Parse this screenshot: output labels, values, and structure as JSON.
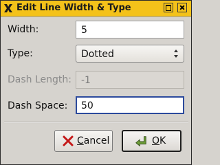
{
  "window": {
    "title": "Edit Line Width & Type",
    "title_color": "#f4c21a"
  },
  "form": {
    "width": {
      "label": "Width:",
      "value": "5"
    },
    "type": {
      "label": "Type:",
      "value": "Dotted"
    },
    "dash_length": {
      "label": "Dash Length:",
      "value": "-1",
      "disabled": true
    },
    "dash_space": {
      "label": "Dash Space:",
      "value": "50"
    }
  },
  "buttons": {
    "cancel": {
      "mnemonic": "C",
      "rest": "ancel",
      "icon": "x-cancel-icon"
    },
    "ok": {
      "mnemonic": "O",
      "rest": "K",
      "icon": "green-arrow-ok-icon"
    }
  }
}
